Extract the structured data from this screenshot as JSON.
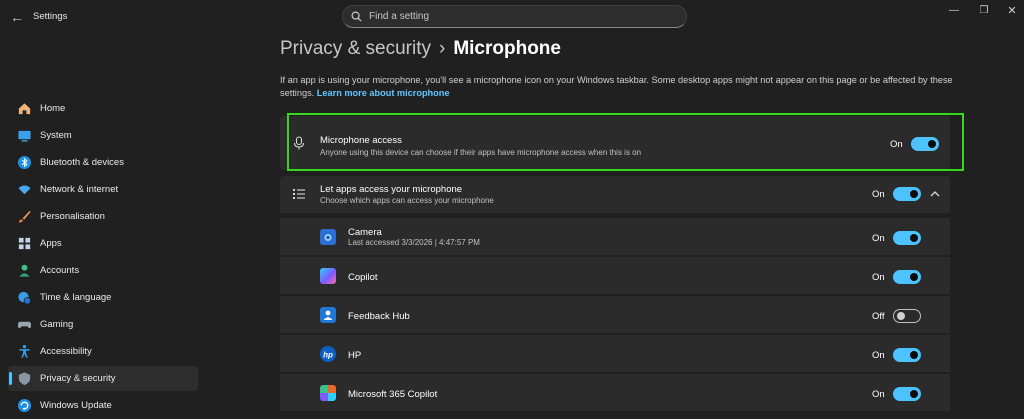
{
  "window": {
    "title": "Settings",
    "search_placeholder": "Find a setting"
  },
  "sidebar": {
    "items": [
      {
        "label": "Home",
        "icon": "home-icon"
      },
      {
        "label": "System",
        "icon": "system-icon"
      },
      {
        "label": "Bluetooth & devices",
        "icon": "bluetooth-icon"
      },
      {
        "label": "Network & internet",
        "icon": "wifi-icon"
      },
      {
        "label": "Personalisation",
        "icon": "brush-icon"
      },
      {
        "label": "Apps",
        "icon": "apps-icon"
      },
      {
        "label": "Accounts",
        "icon": "person-icon"
      },
      {
        "label": "Time & language",
        "icon": "globe-clock-icon"
      },
      {
        "label": "Gaming",
        "icon": "gamepad-icon"
      },
      {
        "label": "Accessibility",
        "icon": "accessibility-icon"
      },
      {
        "label": "Privacy & security",
        "icon": "shield-icon",
        "active": true
      },
      {
        "label": "Windows Update",
        "icon": "update-icon"
      }
    ]
  },
  "header": {
    "parent": "Privacy & security",
    "separator": "›",
    "current": "Microphone"
  },
  "description": {
    "text": "If an app is using your microphone, you'll see a microphone icon on your Windows taskbar. Some desktop apps might not appear on this page or be affected by these settings.",
    "link": "Learn more about microphone"
  },
  "mic_access": {
    "title": "Microphone access",
    "subtitle": "Anyone using this device can choose if their apps have microphone access when this is on",
    "state": "On",
    "enabled": true,
    "icon": "microphone-icon"
  },
  "apps_access": {
    "title": "Let apps access your microphone",
    "subtitle": "Choose which apps can access your microphone",
    "state": "On",
    "enabled": true,
    "icon": "list-icon"
  },
  "apps": [
    {
      "name": "Camera",
      "sub": "Last accessed 3/3/2026  |  4:47:57 PM",
      "state": "On",
      "enabled": true,
      "icon": "camera-app-icon",
      "color": "#2b6fd6"
    },
    {
      "name": "Copilot",
      "sub": "",
      "state": "On",
      "enabled": true,
      "icon": "copilot-app-icon",
      "color": "#7a5cff"
    },
    {
      "name": "Feedback Hub",
      "sub": "",
      "state": "Off",
      "enabled": false,
      "icon": "feedback-hub-icon",
      "color": "#1f78d6"
    },
    {
      "name": "HP",
      "sub": "",
      "state": "On",
      "enabled": true,
      "icon": "hp-app-icon",
      "color": "#0d5fc5"
    },
    {
      "name": "Microsoft 365 Copilot",
      "sub": "",
      "state": "On",
      "enabled": true,
      "icon": "m365-copilot-icon",
      "color": "#e86a2a"
    }
  ],
  "colors": {
    "accent": "#4cc2ff",
    "highlight": "#39d620",
    "background": "#202020",
    "card": "#2b2b2b"
  }
}
